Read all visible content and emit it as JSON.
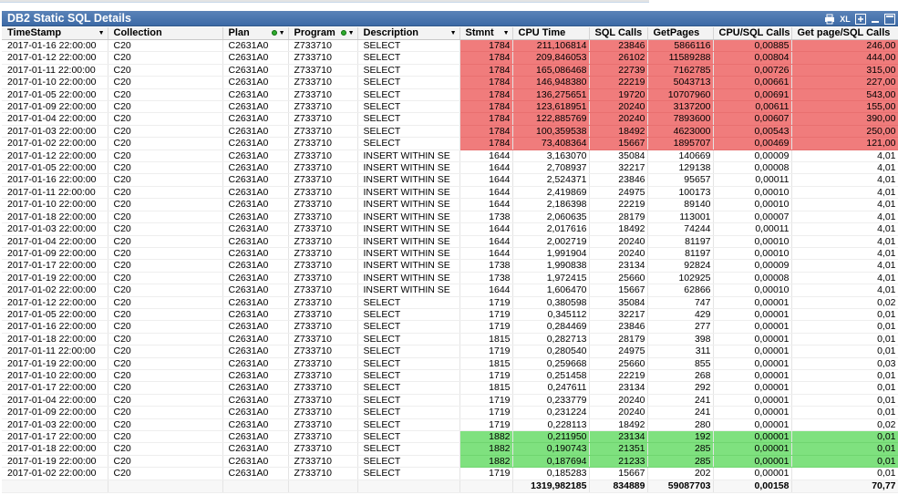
{
  "title": "DB2 Static SQL Details",
  "toolbar": {
    "xl_label": "XL"
  },
  "columns": [
    {
      "label": "TimeStamp",
      "arrow": true,
      "dot": false
    },
    {
      "label": "Collection",
      "arrow": false,
      "dot": false
    },
    {
      "label": "Plan",
      "arrow": true,
      "dot": true
    },
    {
      "label": "Program",
      "arrow": true,
      "dot": true
    },
    {
      "label": "Description",
      "arrow": true,
      "dot": false
    },
    {
      "label": "Stmnt",
      "arrow": true,
      "dot": false
    },
    {
      "label": "CPU Time",
      "arrow": false,
      "dot": false
    },
    {
      "label": "SQL Calls",
      "arrow": false,
      "dot": false
    },
    {
      "label": "GetPages",
      "arrow": false,
      "dot": false
    },
    {
      "label": "CPU/SQL Calls",
      "arrow": false,
      "dot": false
    },
    {
      "label": "Get page/SQL Calls",
      "arrow": false,
      "dot": false
    }
  ],
  "rows": [
    {
      "hl": "red",
      "c": [
        "2017-01-16 22:00:00",
        "C20",
        "C2631A0",
        "Z733710",
        "SELECT",
        "1784",
        "211,106814",
        "23846",
        "5866116",
        "0,00885",
        "246,00"
      ]
    },
    {
      "hl": "red",
      "c": [
        "2017-01-12 22:00:00",
        "C20",
        "C2631A0",
        "Z733710",
        "SELECT",
        "1784",
        "209,846053",
        "26102",
        "11589288",
        "0,00804",
        "444,00"
      ]
    },
    {
      "hl": "red",
      "c": [
        "2017-01-11 22:00:00",
        "C20",
        "C2631A0",
        "Z733710",
        "SELECT",
        "1784",
        "165,086468",
        "22739",
        "7162785",
        "0,00726",
        "315,00"
      ]
    },
    {
      "hl": "red",
      "c": [
        "2017-01-10 22:00:00",
        "C20",
        "C2631A0",
        "Z733710",
        "SELECT",
        "1784",
        "146,948380",
        "22219",
        "5043713",
        "0,00661",
        "227,00"
      ]
    },
    {
      "hl": "red",
      "c": [
        "2017-01-05 22:00:00",
        "C20",
        "C2631A0",
        "Z733710",
        "SELECT",
        "1784",
        "136,275651",
        "19720",
        "10707960",
        "0,00691",
        "543,00"
      ]
    },
    {
      "hl": "red",
      "c": [
        "2017-01-09 22:00:00",
        "C20",
        "C2631A0",
        "Z733710",
        "SELECT",
        "1784",
        "123,618951",
        "20240",
        "3137200",
        "0,00611",
        "155,00"
      ]
    },
    {
      "hl": "red",
      "c": [
        "2017-01-04 22:00:00",
        "C20",
        "C2631A0",
        "Z733710",
        "SELECT",
        "1784",
        "122,885769",
        "20240",
        "7893600",
        "0,00607",
        "390,00"
      ]
    },
    {
      "hl": "red",
      "c": [
        "2017-01-03 22:00:00",
        "C20",
        "C2631A0",
        "Z733710",
        "SELECT",
        "1784",
        "100,359538",
        "18492",
        "4623000",
        "0,00543",
        "250,00"
      ]
    },
    {
      "hl": "red",
      "c": [
        "2017-01-02 22:00:00",
        "C20",
        "C2631A0",
        "Z733710",
        "SELECT",
        "1784",
        "73,408364",
        "15667",
        "1895707",
        "0,00469",
        "121,00"
      ]
    },
    {
      "hl": "",
      "c": [
        "2017-01-12 22:00:00",
        "C20",
        "C2631A0",
        "Z733710",
        "INSERT WITHIN SE",
        "1644",
        "3,163070",
        "35084",
        "140669",
        "0,00009",
        "4,01"
      ]
    },
    {
      "hl": "",
      "c": [
        "2017-01-05 22:00:00",
        "C20",
        "C2631A0",
        "Z733710",
        "INSERT WITHIN SE",
        "1644",
        "2,708937",
        "32217",
        "129138",
        "0,00008",
        "4,01"
      ]
    },
    {
      "hl": "",
      "c": [
        "2017-01-16 22:00:00",
        "C20",
        "C2631A0",
        "Z733710",
        "INSERT WITHIN SE",
        "1644",
        "2,524371",
        "23846",
        "95657",
        "0,00011",
        "4,01"
      ]
    },
    {
      "hl": "",
      "c": [
        "2017-01-11 22:00:00",
        "C20",
        "C2631A0",
        "Z733710",
        "INSERT WITHIN SE",
        "1644",
        "2,419869",
        "24975",
        "100173",
        "0,00010",
        "4,01"
      ]
    },
    {
      "hl": "",
      "c": [
        "2017-01-10 22:00:00",
        "C20",
        "C2631A0",
        "Z733710",
        "INSERT WITHIN SE",
        "1644",
        "2,186398",
        "22219",
        "89140",
        "0,00010",
        "4,01"
      ]
    },
    {
      "hl": "",
      "c": [
        "2017-01-18 22:00:00",
        "C20",
        "C2631A0",
        "Z733710",
        "INSERT WITHIN SE",
        "1738",
        "2,060635",
        "28179",
        "113001",
        "0,00007",
        "4,01"
      ]
    },
    {
      "hl": "",
      "c": [
        "2017-01-03 22:00:00",
        "C20",
        "C2631A0",
        "Z733710",
        "INSERT WITHIN SE",
        "1644",
        "2,017616",
        "18492",
        "74244",
        "0,00011",
        "4,01"
      ]
    },
    {
      "hl": "",
      "c": [
        "2017-01-04 22:00:00",
        "C20",
        "C2631A0",
        "Z733710",
        "INSERT WITHIN SE",
        "1644",
        "2,002719",
        "20240",
        "81197",
        "0,00010",
        "4,01"
      ]
    },
    {
      "hl": "",
      "c": [
        "2017-01-09 22:00:00",
        "C20",
        "C2631A0",
        "Z733710",
        "INSERT WITHIN SE",
        "1644",
        "1,991904",
        "20240",
        "81197",
        "0,00010",
        "4,01"
      ]
    },
    {
      "hl": "",
      "c": [
        "2017-01-17 22:00:00",
        "C20",
        "C2631A0",
        "Z733710",
        "INSERT WITHIN SE",
        "1738",
        "1,990838",
        "23134",
        "92824",
        "0,00009",
        "4,01"
      ]
    },
    {
      "hl": "",
      "c": [
        "2017-01-19 22:00:00",
        "C20",
        "C2631A0",
        "Z733710",
        "INSERT WITHIN SE",
        "1738",
        "1,972415",
        "25660",
        "102925",
        "0,00008",
        "4,01"
      ]
    },
    {
      "hl": "",
      "c": [
        "2017-01-02 22:00:00",
        "C20",
        "C2631A0",
        "Z733710",
        "INSERT WITHIN SE",
        "1644",
        "1,606470",
        "15667",
        "62866",
        "0,00010",
        "4,01"
      ]
    },
    {
      "hl": "",
      "c": [
        "2017-01-12 22:00:00",
        "C20",
        "C2631A0",
        "Z733710",
        "SELECT",
        "1719",
        "0,380598",
        "35084",
        "747",
        "0,00001",
        "0,02"
      ]
    },
    {
      "hl": "",
      "c": [
        "2017-01-05 22:00:00",
        "C20",
        "C2631A0",
        "Z733710",
        "SELECT",
        "1719",
        "0,345112",
        "32217",
        "429",
        "0,00001",
        "0,01"
      ]
    },
    {
      "hl": "",
      "c": [
        "2017-01-16 22:00:00",
        "C20",
        "C2631A0",
        "Z733710",
        "SELECT",
        "1719",
        "0,284469",
        "23846",
        "277",
        "0,00001",
        "0,01"
      ]
    },
    {
      "hl": "",
      "c": [
        "2017-01-18 22:00:00",
        "C20",
        "C2631A0",
        "Z733710",
        "SELECT",
        "1815",
        "0,282713",
        "28179",
        "398",
        "0,00001",
        "0,01"
      ]
    },
    {
      "hl": "",
      "c": [
        "2017-01-11 22:00:00",
        "C20",
        "C2631A0",
        "Z733710",
        "SELECT",
        "1719",
        "0,280540",
        "24975",
        "311",
        "0,00001",
        "0,01"
      ]
    },
    {
      "hl": "",
      "c": [
        "2017-01-19 22:00:00",
        "C20",
        "C2631A0",
        "Z733710",
        "SELECT",
        "1815",
        "0,259668",
        "25660",
        "855",
        "0,00001",
        "0,03"
      ]
    },
    {
      "hl": "",
      "c": [
        "2017-01-10 22:00:00",
        "C20",
        "C2631A0",
        "Z733710",
        "SELECT",
        "1719",
        "0,251458",
        "22219",
        "268",
        "0,00001",
        "0,01"
      ]
    },
    {
      "hl": "",
      "c": [
        "2017-01-17 22:00:00",
        "C20",
        "C2631A0",
        "Z733710",
        "SELECT",
        "1815",
        "0,247611",
        "23134",
        "292",
        "0,00001",
        "0,01"
      ]
    },
    {
      "hl": "",
      "c": [
        "2017-01-04 22:00:00",
        "C20",
        "C2631A0",
        "Z733710",
        "SELECT",
        "1719",
        "0,233779",
        "20240",
        "241",
        "0,00001",
        "0,01"
      ]
    },
    {
      "hl": "",
      "c": [
        "2017-01-09 22:00:00",
        "C20",
        "C2631A0",
        "Z733710",
        "SELECT",
        "1719",
        "0,231224",
        "20240",
        "241",
        "0,00001",
        "0,01"
      ]
    },
    {
      "hl": "",
      "c": [
        "2017-01-03 22:00:00",
        "C20",
        "C2631A0",
        "Z733710",
        "SELECT",
        "1719",
        "0,228113",
        "18492",
        "280",
        "0,00001",
        "0,02"
      ]
    },
    {
      "hl": "green",
      "c": [
        "2017-01-17 22:00:00",
        "C20",
        "C2631A0",
        "Z733710",
        "SELECT",
        "1882",
        "0,211950",
        "23134",
        "192",
        "0,00001",
        "0,01"
      ]
    },
    {
      "hl": "green",
      "c": [
        "2017-01-18 22:00:00",
        "C20",
        "C2631A0",
        "Z733710",
        "SELECT",
        "1882",
        "0,190743",
        "21351",
        "285",
        "0,00001",
        "0,01"
      ]
    },
    {
      "hl": "green",
      "c": [
        "2017-01-19 22:00:00",
        "C20",
        "C2631A0",
        "Z733710",
        "SELECT",
        "1882",
        "0,187694",
        "21233",
        "285",
        "0,00001",
        "0,01"
      ]
    },
    {
      "hl": "",
      "c": [
        "2017-01-02 22:00:00",
        "C20",
        "C2631A0",
        "Z733710",
        "SELECT",
        "1719",
        "0,185283",
        "15667",
        "202",
        "0,00001",
        "0,01"
      ]
    }
  ],
  "totals": [
    "",
    "",
    "",
    "",
    "",
    "",
    "1319,982185",
    "834889",
    "59087703",
    "0,00158",
    "70,77"
  ],
  "colors": {
    "title_bg": "#3c6aa6",
    "highlight_red": "#f07c7c",
    "highlight_green": "#7fe17f"
  },
  "icons": [
    "print-icon",
    "xl-export-icon",
    "restore-icon",
    "minimize-icon",
    "maximize-icon"
  ]
}
